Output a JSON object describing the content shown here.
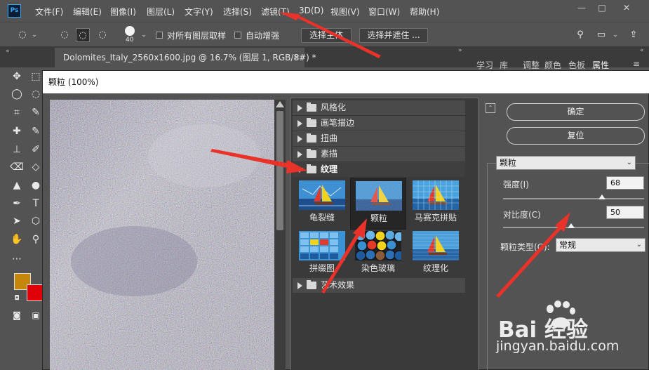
{
  "app": {
    "logo": "Ps",
    "menu": [
      "文件(F)",
      "编辑(E)",
      "图像(I)",
      "图层(L)",
      "文字(Y)",
      "选择(S)",
      "滤镜(T)",
      "3D(D)",
      "视图(V)",
      "窗口(W)",
      "帮助(H)"
    ],
    "window_controls": [
      "—",
      "□",
      "✕"
    ]
  },
  "options_bar": {
    "brush_size": "40",
    "sample_all_layers_label": "对所有图层取样",
    "auto_enhance_label": "自动增强",
    "select_subject_label": "选择主体",
    "select_and_mask_label": "选择并遮住 ..."
  },
  "document_tab": {
    "title": "Dolomites_Italy_2560x1600.jpg @ 16.7% (图层 1, RGB/8#) *",
    "close": "×"
  },
  "right_panel_tabs": [
    "学习",
    "库",
    "调整",
    "颜色",
    "色板",
    "属性"
  ],
  "dialog": {
    "title": "颗粒 (100%)",
    "ok_label": "确定",
    "reset_label": "复位",
    "categories_top": [
      "风格化",
      "画笔描边",
      "扭曲",
      "素描"
    ],
    "open_category": "纹理",
    "thumbnails": [
      {
        "label": "龟裂缝",
        "selected": false
      },
      {
        "label": "颗粒",
        "selected": true
      },
      {
        "label": "马赛克拼贴",
        "selected": false
      },
      {
        "label": "拼缀图",
        "selected": false
      },
      {
        "label": "染色玻璃",
        "selected": false
      },
      {
        "label": "纹理化",
        "selected": false
      }
    ],
    "categories_bottom": [
      "艺术效果"
    ],
    "filter_select": "颗粒",
    "intensity_label": "强度(I)",
    "intensity_value": "68",
    "intensity_level": 0.68,
    "contrast_label": "对比度(C)",
    "contrast_value": "50",
    "contrast_level": 0.5,
    "grain_type_label": "颗粒类型(G):",
    "grain_type_value": "常规"
  },
  "watermark": {
    "brand": "Bai 经验",
    "url": "jingyan.baidu.com"
  },
  "colors": {
    "foreground": "#c4870c",
    "background": "#e00008",
    "annotation": "#e8322a"
  }
}
